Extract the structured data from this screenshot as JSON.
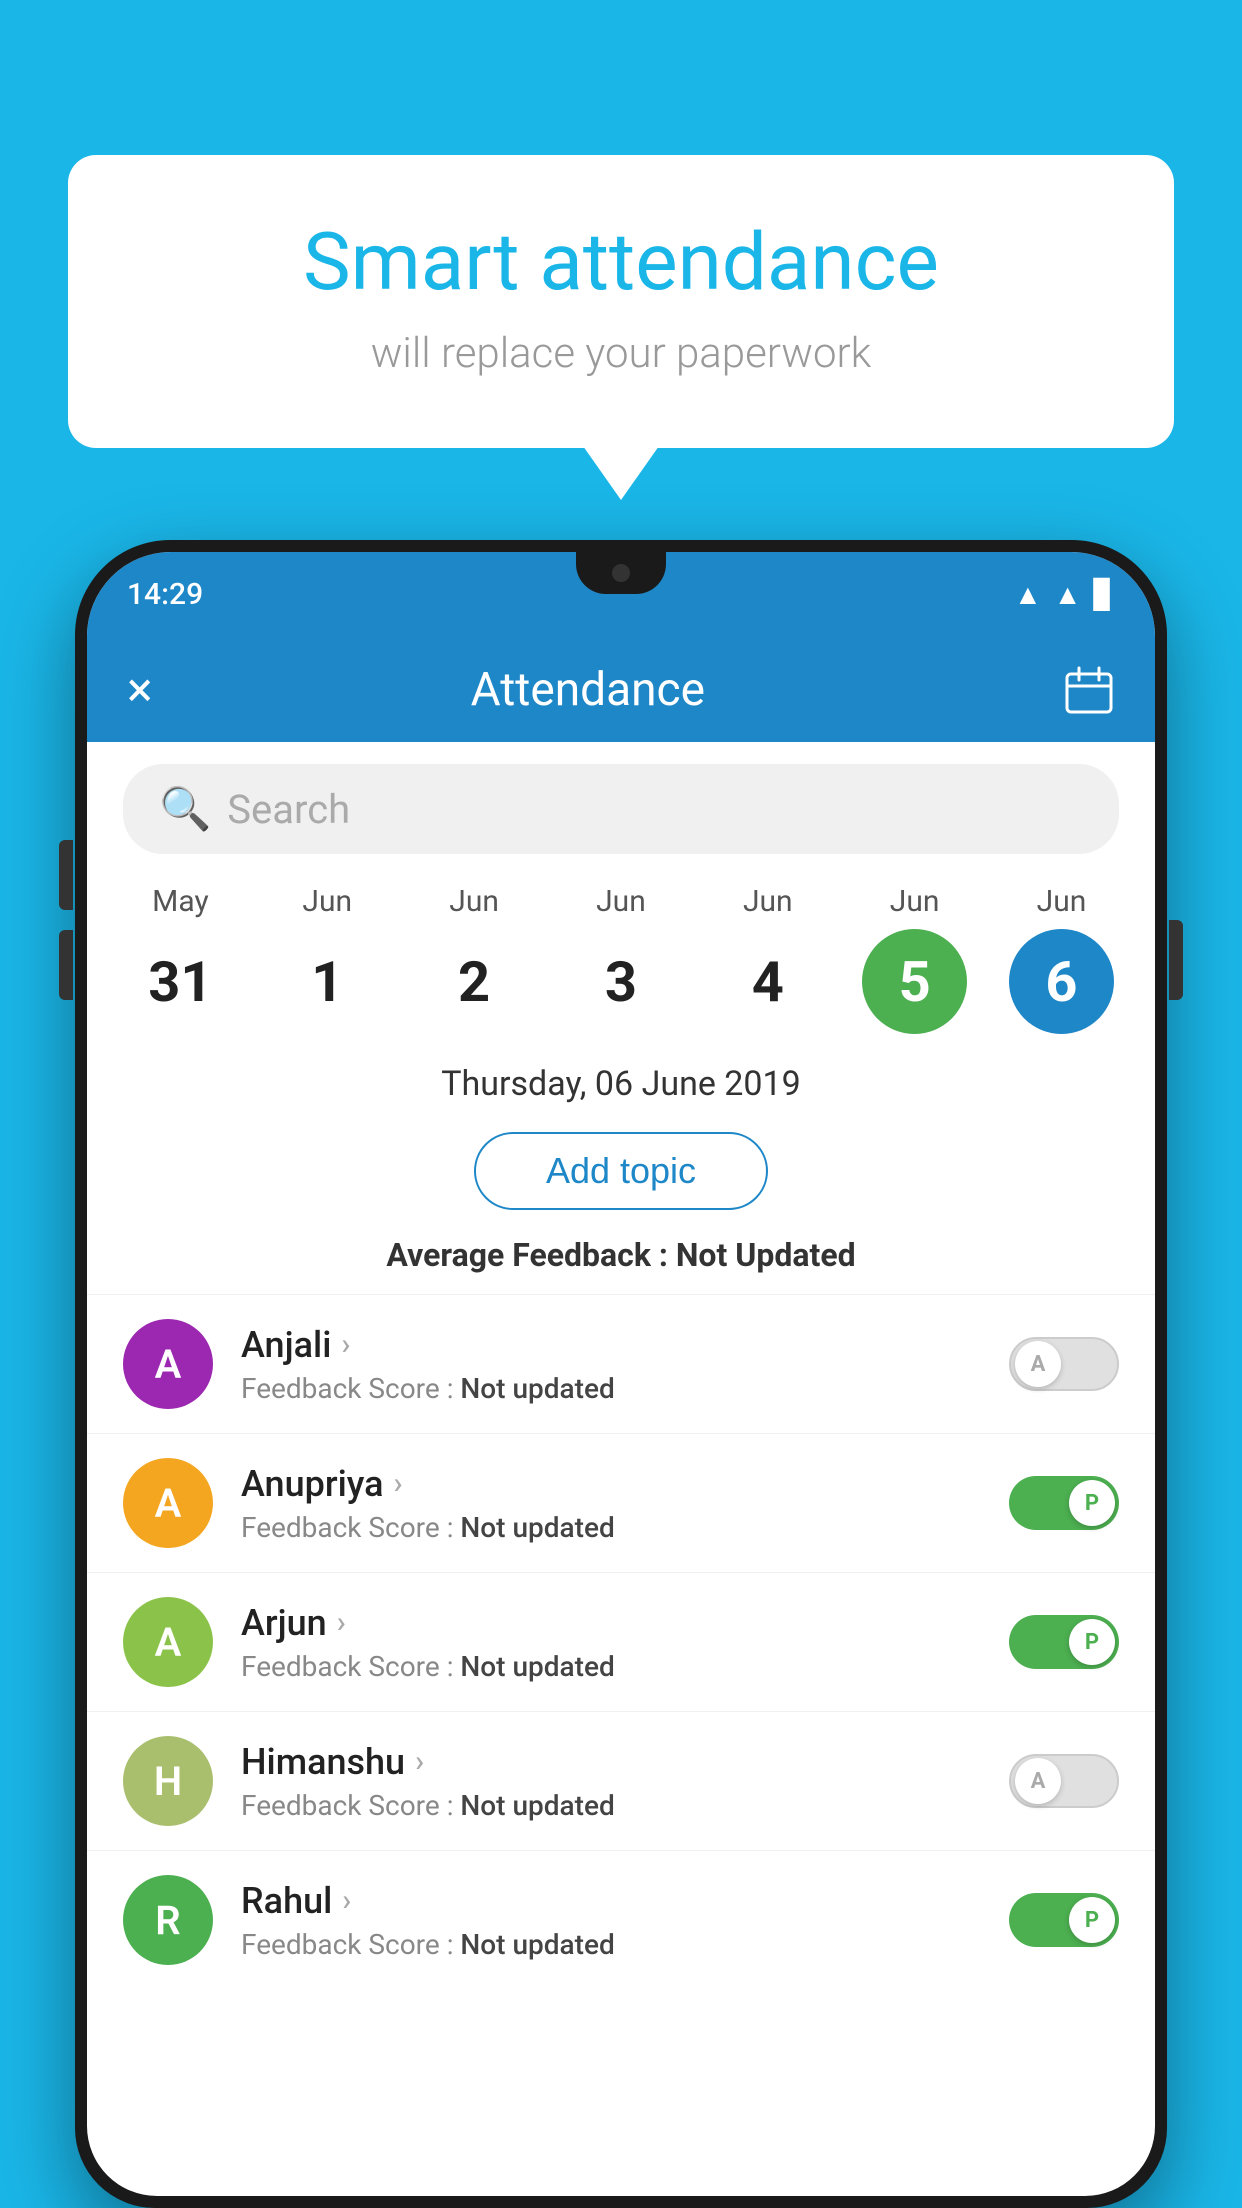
{
  "background_color": "#1ab6e8",
  "speech_bubble": {
    "title": "Smart attendance",
    "subtitle": "will replace your paperwork"
  },
  "status_bar": {
    "time": "14:29",
    "icons": [
      "wifi",
      "signal",
      "battery"
    ]
  },
  "app_bar": {
    "title": "Attendance",
    "close_label": "×",
    "calendar_icon": "calendar"
  },
  "search": {
    "placeholder": "Search"
  },
  "calendar": {
    "days": [
      {
        "month": "May",
        "date": "31",
        "state": "normal"
      },
      {
        "month": "Jun",
        "date": "1",
        "state": "normal"
      },
      {
        "month": "Jun",
        "date": "2",
        "state": "normal"
      },
      {
        "month": "Jun",
        "date": "3",
        "state": "normal"
      },
      {
        "month": "Jun",
        "date": "4",
        "state": "normal"
      },
      {
        "month": "Jun",
        "date": "5",
        "state": "today"
      },
      {
        "month": "Jun",
        "date": "6",
        "state": "selected"
      }
    ]
  },
  "selected_date": "Thursday, 06 June 2019",
  "add_topic_label": "Add topic",
  "average_feedback": {
    "label": "Average Feedback : ",
    "value": "Not Updated"
  },
  "students": [
    {
      "name": "Anjali",
      "avatar_letter": "A",
      "avatar_color": "#9c27b0",
      "feedback_label": "Feedback Score : ",
      "feedback_value": "Not updated",
      "toggle": "off",
      "toggle_letter": "A"
    },
    {
      "name": "Anupriya",
      "avatar_letter": "A",
      "avatar_color": "#f4a620",
      "feedback_label": "Feedback Score : ",
      "feedback_value": "Not updated",
      "toggle": "on",
      "toggle_letter": "P"
    },
    {
      "name": "Arjun",
      "avatar_letter": "A",
      "avatar_color": "#8bc34a",
      "feedback_label": "Feedback Score : ",
      "feedback_value": "Not updated",
      "toggle": "on",
      "toggle_letter": "P"
    },
    {
      "name": "Himanshu",
      "avatar_letter": "H",
      "avatar_color": "#aabf6e",
      "feedback_label": "Feedback Score : ",
      "feedback_value": "Not updated",
      "toggle": "off",
      "toggle_letter": "A"
    },
    {
      "name": "Rahul",
      "avatar_letter": "R",
      "avatar_color": "#4caf50",
      "feedback_label": "Feedback Score : ",
      "feedback_value": "Not updated",
      "toggle": "on",
      "toggle_letter": "P"
    }
  ]
}
